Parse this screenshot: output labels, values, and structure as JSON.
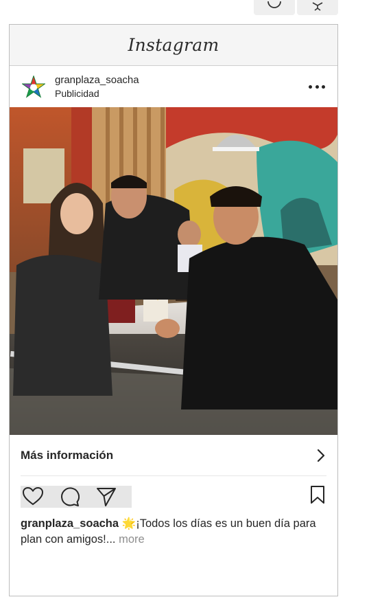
{
  "post": {
    "header_logo": "Instagram",
    "username": "granplaza_soacha",
    "sponsored_label": "Publicidad",
    "cta_label": "Más información",
    "caption_user": "granplaza_soacha",
    "caption_emoji": "🌟",
    "caption_text": "¡Todos los días es un buen día para plan con amigos!...",
    "caption_more": "more"
  },
  "icons": {
    "top_tool_1": "circle-icon",
    "top_tool_2": "accessibility-icon",
    "more": "more-options-icon",
    "cta": "chevron-right-icon",
    "like": "heart-icon",
    "comment": "comment-icon",
    "share": "send-icon",
    "save": "bookmark-icon"
  },
  "colors": {
    "text": "#262626",
    "muted": "#8e8e8e",
    "header_bg": "#f5f5f5",
    "border": "#bdbdbd"
  }
}
